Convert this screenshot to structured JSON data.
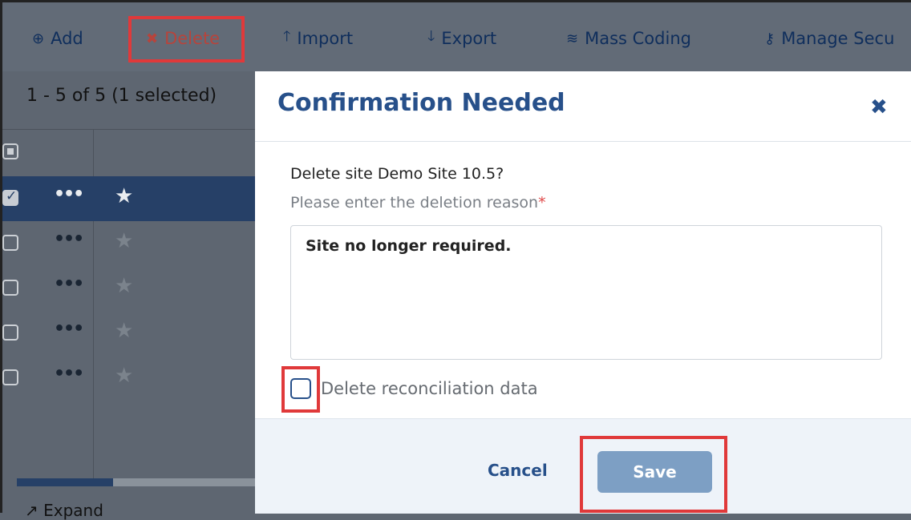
{
  "toolbar": {
    "add_label": "Add",
    "delete_label": "Delete",
    "import_label": "Import",
    "export_label": "Export",
    "mass_coding_label": "Mass Coding",
    "manage_security_label": "Manage Secu"
  },
  "list": {
    "count_text": "1 - 5 of 5 (1 selected)",
    "expand_label": "Expand",
    "rows": [
      {
        "selected": true
      },
      {
        "selected": false
      },
      {
        "selected": false
      },
      {
        "selected": false
      },
      {
        "selected": false
      }
    ]
  },
  "modal": {
    "title": "Confirmation Needed",
    "close_symbol": "✖",
    "question": "Delete site Demo Site 10.5?",
    "reason_label": "Please enter the deletion reason",
    "required_marker": "*",
    "reason_value": "Site no longer required.",
    "checkbox_label": "Delete reconciliation data",
    "checkbox_checked": false,
    "cancel_label": "Cancel",
    "save_label": "Save"
  },
  "colors": {
    "accent": "#27508a",
    "highlight_box": "#e0393a",
    "save_button": "#7d9fc4",
    "selected_row": "#264067"
  }
}
